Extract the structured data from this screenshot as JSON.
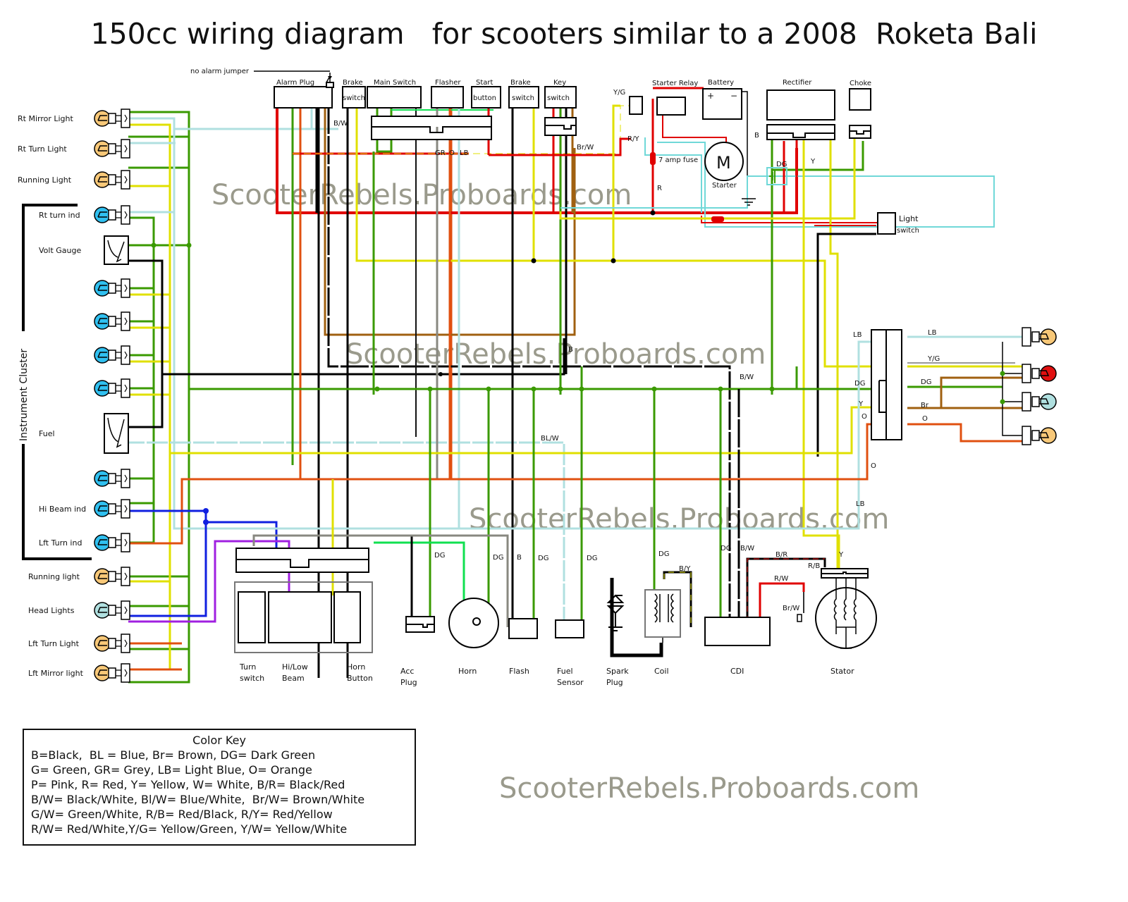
{
  "title": "150cc wiring diagram   for scooters similar to a 2008  Roketa Bali",
  "watermarks": [
    "ScooterRebels.Proboards.com",
    "ScooterRebels.Proboards.com",
    "ScooterRebels.Proboards.com",
    "ScooterRebels.Proboards.com"
  ],
  "colors": {
    "black": "#000000",
    "red": "#e00000",
    "orange": "#e05010",
    "yellow": "#e0e000",
    "green": "#3a9a00",
    "bright_green": "#10e050",
    "light_blue": "#b0e0e0",
    "cyan_box": "#70d8d8",
    "blue": "#1020e0",
    "purple": "#a020e0",
    "brown": "#a06010",
    "grey": "#888880",
    "bulb_amber": "#f8c878",
    "bulb_blue": "#30c0f0",
    "bulb_red": "#e01010",
    "bulb_lightblue": "#b0e0e0"
  },
  "left_components": [
    {
      "label": "Rt Mirror Light",
      "type": "bulb-amber"
    },
    {
      "label": "Rt Turn Light",
      "type": "bulb-amber"
    },
    {
      "label": "Running Light",
      "type": "bulb-amber"
    },
    {
      "label": "Rt turn ind",
      "type": "bulb-blue"
    },
    {
      "label": "Volt Gauge",
      "type": "gauge"
    },
    {
      "label": "",
      "type": "bulb-blue"
    },
    {
      "label": "",
      "type": "bulb-blue"
    },
    {
      "label": "",
      "type": "bulb-blue"
    },
    {
      "label": "",
      "type": "bulb-blue"
    },
    {
      "label": "Fuel",
      "type": "gauge"
    },
    {
      "label": "",
      "type": "bulb-blue"
    },
    {
      "label": "Hi Beam ind",
      "type": "bulb-blue"
    },
    {
      "label": "Lft Turn ind",
      "type": "bulb-blue"
    },
    {
      "label": "Running light",
      "type": "bulb-amber"
    },
    {
      "label": "Head Lights",
      "type": "bulb-lightblue"
    },
    {
      "label": "Lft Turn Light",
      "type": "bulb-amber"
    },
    {
      "label": "Lft Mirror light",
      "type": "bulb-amber"
    }
  ],
  "instrument_cluster_label": "Instrument Cluster",
  "top_components": {
    "no_alarm_jumper": "no alarm jumper",
    "alarm_plug": "Alarm Plug",
    "brake_switch_1": {
      "top": "Brake",
      "inner": "switch"
    },
    "main_switch": "Main Switch",
    "flasher": "Flasher",
    "start_button": {
      "top": "Start",
      "inner": "button"
    },
    "brake_switch_2": {
      "top": "Brake",
      "inner": "switch"
    },
    "key_switch": {
      "top": "Key",
      "inner": "switch"
    },
    "starter_relay": "Starter Relay",
    "battery": {
      "label": "Battery",
      "plus": "+",
      "minus": "−"
    },
    "rectifier": "Rectifier",
    "choke": "Choke",
    "starter": {
      "label": "Starter",
      "symbol": "M"
    },
    "fuse": "7 amp fuse",
    "light_switch": {
      "line1": "Light",
      "line2": "switch"
    }
  },
  "bottom_components": [
    {
      "label": "Turn\nswitch"
    },
    {
      "label": "Hi/Low\nBeam"
    },
    {
      "label": "Horn\nButton"
    },
    {
      "label": "Acc\nPlug"
    },
    {
      "label": "Horn"
    },
    {
      "label": "Flash"
    },
    {
      "label": "Fuel\nSensor"
    },
    {
      "label": "Spark\nPlug"
    },
    {
      "label": "Coil"
    },
    {
      "label": "CDI"
    },
    {
      "label": "Stator"
    }
  ],
  "wire_labels": {
    "bw_top": "B/W",
    "gr": "GR",
    "o": "O",
    "lb": "LB",
    "brw_top": "Br/W",
    "yg_top": "Y/G",
    "ry": "R/Y",
    "r": "R",
    "b_batt": "B",
    "dg_rect": "DG",
    "y_rect": "Y",
    "b_mid": "B",
    "bw_mid": "B/W",
    "blw": "BL/W",
    "rear_lb_in": "LB",
    "rear_dg_in": "DG",
    "rear_y_in": "Y",
    "rear_o_in": "O",
    "rear_lb_out": "LB",
    "rear_yg_out": "Y/G",
    "rear_dg_out": "DG",
    "rear_br_out": "Br",
    "rear_o_out": "O",
    "o_loose": "O",
    "lb_loose": "LB",
    "dg1": "DG",
    "dg2": "DG",
    "b_flash": "B",
    "dg3": "DG",
    "dg4": "DG",
    "dg5": "DG",
    "dg6": "DG",
    "bw_cdi": "B/W",
    "by": "B/Y",
    "br": "B/R",
    "rb": "R/B",
    "rw": "R/W",
    "brw_stator": "Br/W",
    "y_stator": "Y"
  },
  "color_key": {
    "title": "Color Key",
    "lines": [
      "B=Black,  BL = Blue, Br= Brown, DG= Dark Green",
      "G= Green, GR= Grey, LB= Light Blue, O= Orange",
      "P= Pink, R= Red, Y= Yellow, W= White, B/R= Black/Red",
      "B/W= Black/White, Bl/W= Blue/White,  Br/W= Brown/White",
      "G/W= Green/White, R/B= Red/Black, R/Y= Red/Yellow",
      "R/W= Red/White,Y/G= Yellow/Green, Y/W= Yellow/White"
    ]
  }
}
